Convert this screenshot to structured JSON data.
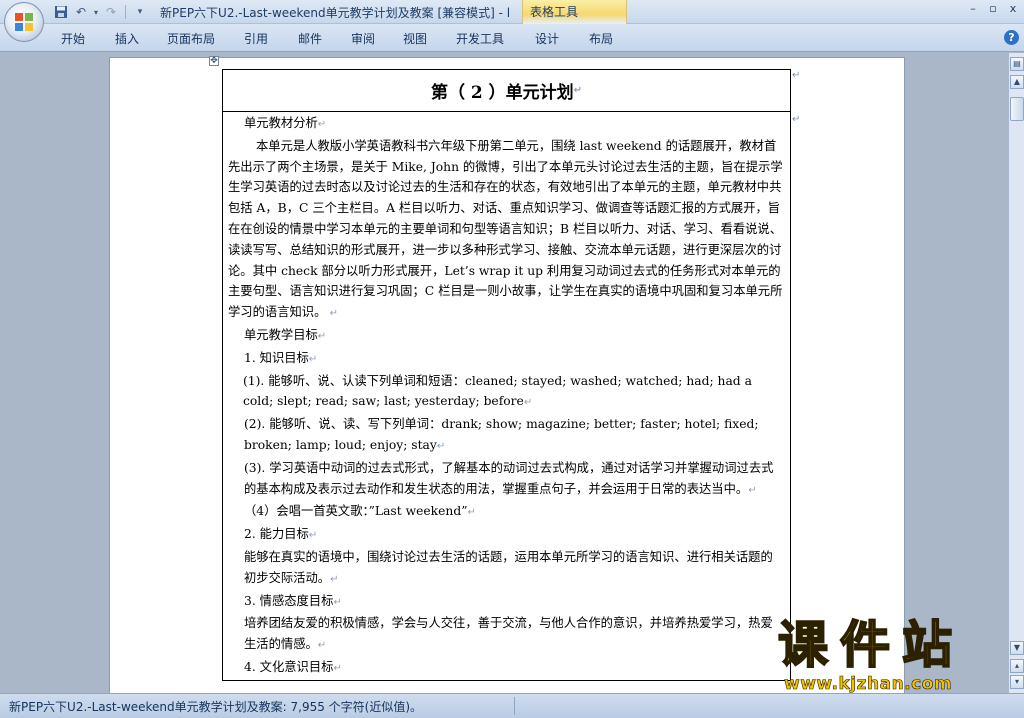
{
  "titlebar": {
    "document_title": "新PEP六下U2.-Last-weekend单元教学计划及教案 [兼容模式] - l",
    "context_tab": "表格工具",
    "window_controls": [
      "–",
      "▫",
      "x"
    ]
  },
  "quick_access": {
    "icons": [
      "save-icon",
      "undo-icon",
      "redo-icon",
      "customize-icon"
    ]
  },
  "ribbon": {
    "tabs": [
      "开始",
      "插入",
      "页面布局",
      "引用",
      "邮件",
      "审阅",
      "视图",
      "开发工具",
      "设计",
      "布局"
    ],
    "help_label": "?"
  },
  "document": {
    "table_title": "第（ 2 ）单元计划",
    "section_analysis": "单元教材分析",
    "analysis_para": "本单元是人教版小学英语教科书六年级下册第二单元，围绕 last weekend 的话题展开，教材首先出示了两个主场景，是关于 Mike, John 的微博，引出了本单元头讨论过去生活的主题，旨在提示学生学习英语的过去时态以及讨论过去的生活和存在的状态，有效地引出了本单元的主题，单元教材中共包括 A，B，C 三个主栏目。A 栏目以听力、对话、重点知识学习、做调查等话题汇报的方式展开，旨在在创设的情景中学习本单元的主要单词和句型等语言知识；B 栏目以听力、对话、学习、看看说说、读读写写、总结知识的形式展开，进一步以多种形式学习、接触、交流本单元话题，进行更深层次的讨论。其中 check 部分以听力形式展开，Let’s wrap it up 利用复习动词过去式的任务形式对本单元的主要句型、语言知识进行复习巩固；C 栏目是一则小故事，让学生在真实的语境中巩固和复习本单元所学习的语言知识。",
    "section_goals": "单元教学目标",
    "goal1_title": "1.   知识目标",
    "goal1_item1": "(1). 能够听、说、认读下列单词和短语：cleaned; stayed; washed; watched; had; had a cold; slept; read; saw; last; yesterday; before",
    "goal1_item2": "(2). 能够听、说、读、写下列单词：drank; show; magazine; better; faster; hotel; fixed; broken; lamp; loud; enjoy; stay",
    "goal1_item3": "(3). 学习英语中动词的过去式形式，了解基本的动词过去式构成，通过对话学习并掌握动词过去式的基本构成及表示过去动作和发生状态的用法，掌握重点句子，并会运用于日常的表达当中。",
    "goal1_item4": "（4）会唱一首英文歌：”Last weekend”",
    "goal2_title": "2.   能力目标",
    "goal2_text": "能够在真实的语境中，围绕讨论过去生活的话题，运用本单元所学习的语言知识、进行相关话题的初步交际活动。",
    "goal3_title": "3.   情感态度目标",
    "goal3_text": "培养团结友爱的积极情感，学会与人交往，善于交流，与他人合作的意识，并培养热爱学习，热爱生活的情感。",
    "goal4_title": "4.   文化意识目标"
  },
  "watermark": {
    "main": "课件站",
    "url": "www.kjzhan.com"
  },
  "statusbar": {
    "text": "新PEP六下U2.-Last-weekend单元教学计划及教案: 7,955 个字符(近似值)。"
  },
  "colors": {
    "ribbon_bg": "#c4d5eb",
    "workspace_bg": "#a9b7c8",
    "context_tab": "#f5d870",
    "watermark": "#f3c200"
  }
}
